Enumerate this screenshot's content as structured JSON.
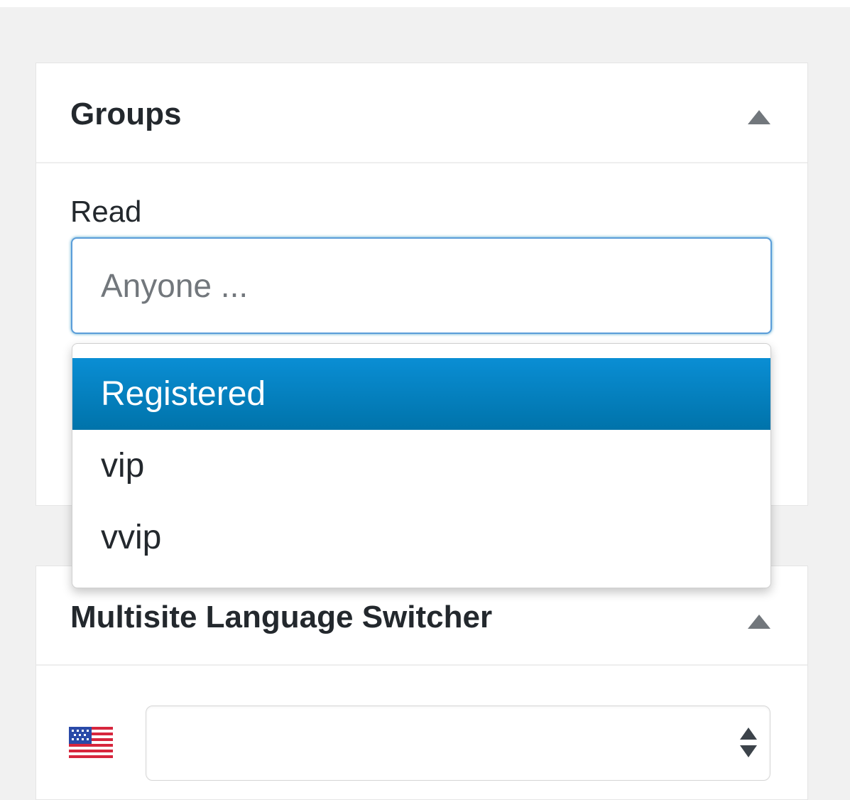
{
  "groups_panel": {
    "title": "Groups",
    "toggle_icon": "triangle-up-icon",
    "read_label": "Read",
    "read_input": {
      "placeholder": "Anyone ...",
      "value": ""
    },
    "dropdown_options": [
      {
        "label": "Registered",
        "selected": true
      },
      {
        "label": "vip",
        "selected": false
      },
      {
        "label": "vvip",
        "selected": false
      }
    ]
  },
  "msls_panel": {
    "title": "Multisite Language Switcher",
    "toggle_icon": "triangle-up-icon",
    "flag_icon": "us-flag-icon",
    "language_select": {
      "value": ""
    }
  },
  "colors": {
    "background": "#f1f1f1",
    "panel": "#ffffff",
    "focus_border": "#5b9dd9",
    "selected_option": "#0073aa",
    "text": "#23282d",
    "muted_text": "#72777c"
  }
}
